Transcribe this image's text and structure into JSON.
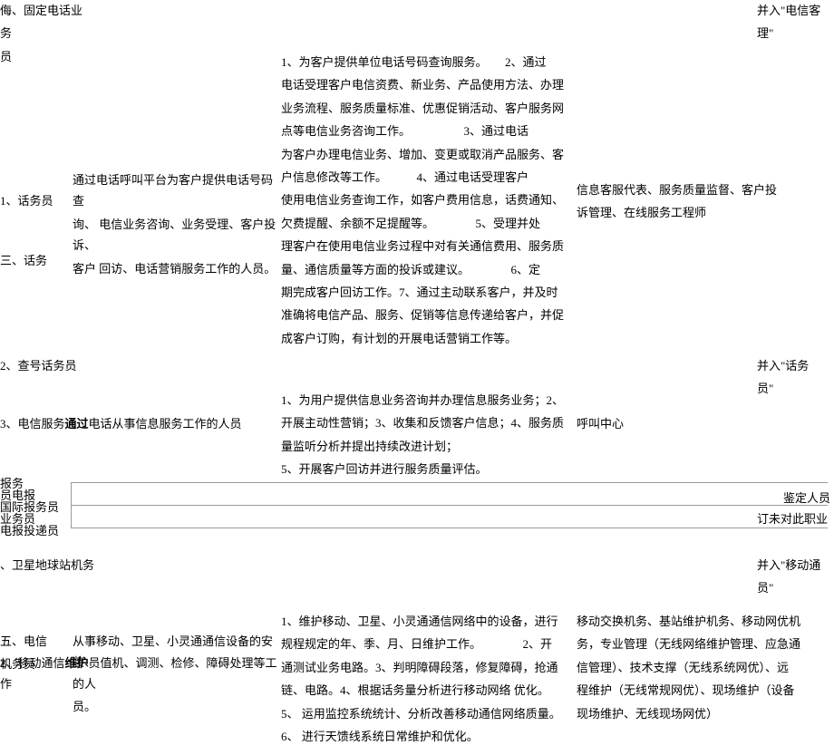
{
  "row0": {
    "left1": "侮、固定电话业",
    "left2": "务",
    "left3": "员",
    "right1": "并入\"电信客",
    "right2": "理\""
  },
  "row1": {
    "left_header_1": "1、话务员",
    "left_header_2": "三、话务",
    "desc_1": "通过电话呼叫平台为客户提供电话号码查",
    "desc_2": "询、 电信业务咨询、业务受理、客户投诉、",
    "desc_3": "客户 回访、电话营销服务工作的人员。",
    "duties_1": "1、为客户提供单位电话号码查询服务。　　2、通过",
    "duties_2": "电话受理客户电信资费、新业务、产品使用方法、办理",
    "duties_3": "业务流程、服务质量标准、优惠促销活动、客户服务网",
    "duties_4": "点等电信业务咨询工作。　　　　　3、通过电话",
    "duties_5": "为客户办理电信业务、增加、变更或取消产品服务、客",
    "duties_6": "户信息修改等工作。　　　4、通过电话受理客户",
    "duties_7": "使用电信业务查询工作，如客户费用信息，话费通知、",
    "duties_8": "欠费提醒、余额不足提醒等。　　　　5、受理并处",
    "duties_9": "理客户在使用电信业务过程中对有关通信费用、服务质",
    "duties_10": "量、通信质量等方面的投诉或建议。　　　　6、定",
    "duties_11": "期完成客户回访工作。7、通过主动联系客户，并及时",
    "duties_12": "准确将电信产品、服务、促销等信息传递给客户，并促",
    "duties_13": "成客户订购，有计划的开展电话营销工作等。",
    "right_1": "信息客服代表、服务质量监督、客户投",
    "right_2": "诉管理、在线服务工程师"
  },
  "row2": {
    "left": "2、查号话务员",
    "right_1": "并入\"话务",
    "right_2": "员\""
  },
  "row3": {
    "left_header": "3、电信服务",
    "left_suffix": "电话从事信息服务工作的人员",
    "left_mid_bold": "通过",
    "duties_1": "1、为用户提供信息业务咨询并办理信息服务业务；2、",
    "duties_2": "开展主动性营销；3、收集和反馈客户信息；4、服务质",
    "duties_3": "量监听分析并提出持续改进计划；",
    "duties_4": "5、开展客户回访并进行服务质量评估。",
    "right": "呼叫中心"
  },
  "row4": {
    "l1": "报务",
    "l2": "员",
    "l2b": "电报",
    "l3": "国际报务员",
    "l3b": "业务员",
    "l4": "电报投递员",
    "r1": "鉴定人员",
    "r2": "订未对此职业"
  },
  "row5": {
    "left": "、卫星地球站机务",
    "right_1": "并入\"移动通",
    "right_2": "员\""
  },
  "row6": {
    "left_header_1": "五、电信",
    "left_header_2": "机务员",
    "sub_1": "从事移动、卫星、小灵通通信设备的安装、",
    "sub_2_pre": "2、移动通信",
    "sub_2_bold": "维护",
    "sub_2_post": "员值机、调测、检修、障碍处理等工作",
    "sub_3": "的人",
    "sub_4": "员。",
    "duties_1": "1、维护移动、卫星、小灵通通信网络中的设备，进行",
    "duties_2": "规程规定的年、季、月、日维护工作。　　　　2、开",
    "duties_3": "通测试业务电路。3、判明障碍段落，修复障碍，抢通",
    "duties_4": "链、电路。4、根据话务量分析进行移动网络 优化。",
    "duties_5": "5、 运用监控系统统计、分析改善移动通信网络质量。",
    "duties_6": "6、 进行天馈线系统日常维护和优化。",
    "right_1": "移动交换机务、基站维护机务、移动网优机",
    "right_2": "务，专业管理（无线网络维护管理、应急通",
    "right_3": "信管理）、技术支撑（无线系统网优）、远",
    "right_4": "程维护（无线常规网优）、现场维护（设备",
    "right_5": "现场维护、无线现场网优）"
  }
}
